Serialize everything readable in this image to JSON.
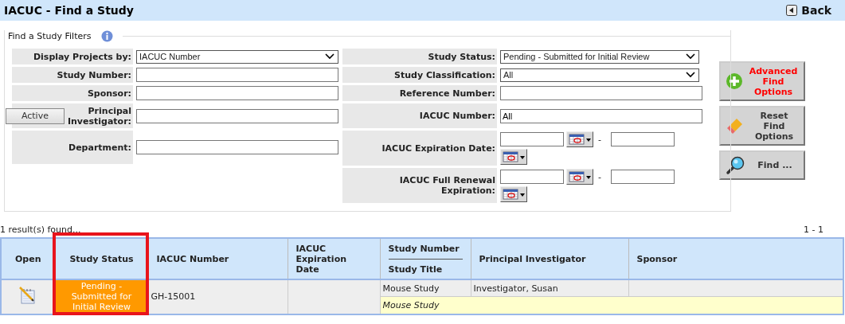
{
  "header": {
    "title": "IACUC - Find a Study",
    "back_button": "Back"
  },
  "filters": {
    "legend": "Find a Study Filters",
    "left": [
      {
        "kind": "select",
        "label": "Display Projects by:",
        "value": "IACUC Number"
      },
      {
        "kind": "text",
        "label": "Study Number:"
      },
      {
        "kind": "text",
        "label": "Sponsor:"
      },
      {
        "kind": "text",
        "label": "Principal Investigator:",
        "toggle": "Active"
      },
      {
        "kind": "text",
        "label": "Department:"
      }
    ],
    "right": [
      {
        "kind": "select",
        "label": "Study Status:",
        "value": "Pending - Submitted for Initial Review"
      },
      {
        "kind": "select",
        "label": "Study Classification:",
        "value": "All"
      },
      {
        "kind": "text",
        "label": "Reference Number:"
      },
      {
        "kind": "text",
        "label": "IACUC Number:",
        "value": "All"
      },
      {
        "kind": "daterange",
        "label": "IACUC Expiration Date:",
        "separator": "-"
      },
      {
        "kind": "daterange",
        "label": "IACUC Full Renewal Expiration:",
        "separator": "-"
      }
    ]
  },
  "actions": [
    {
      "kind": "advanced",
      "label": "Advanced Find Options"
    },
    {
      "kind": "reset",
      "label": "Reset Find Options"
    },
    {
      "kind": "find",
      "label": "Find ..."
    }
  ],
  "results": {
    "summary": "1 result(s) found...",
    "range": "1 - 1",
    "columns": [
      {
        "label": "Open",
        "highlighted": false
      },
      {
        "label": "Study Status",
        "highlighted": true
      },
      {
        "label": "IACUC Number",
        "highlighted": false
      },
      {
        "label": "IACUC Expiration Date",
        "highlighted": false
      },
      {
        "label": "Study Number",
        "sub_label": "Study Title",
        "highlighted": false
      },
      {
        "label": "Principal Investigator",
        "highlighted": false
      },
      {
        "label": "Sponsor",
        "highlighted": false
      }
    ],
    "rows": [
      {
        "status": "Pending - Submitted for Initial Review",
        "iacuc_number": "GH-15001",
        "study_number": "Mouse Study",
        "principal_investigator": "Investigator, Susan",
        "study_title": "Mouse Study"
      }
    ]
  }
}
